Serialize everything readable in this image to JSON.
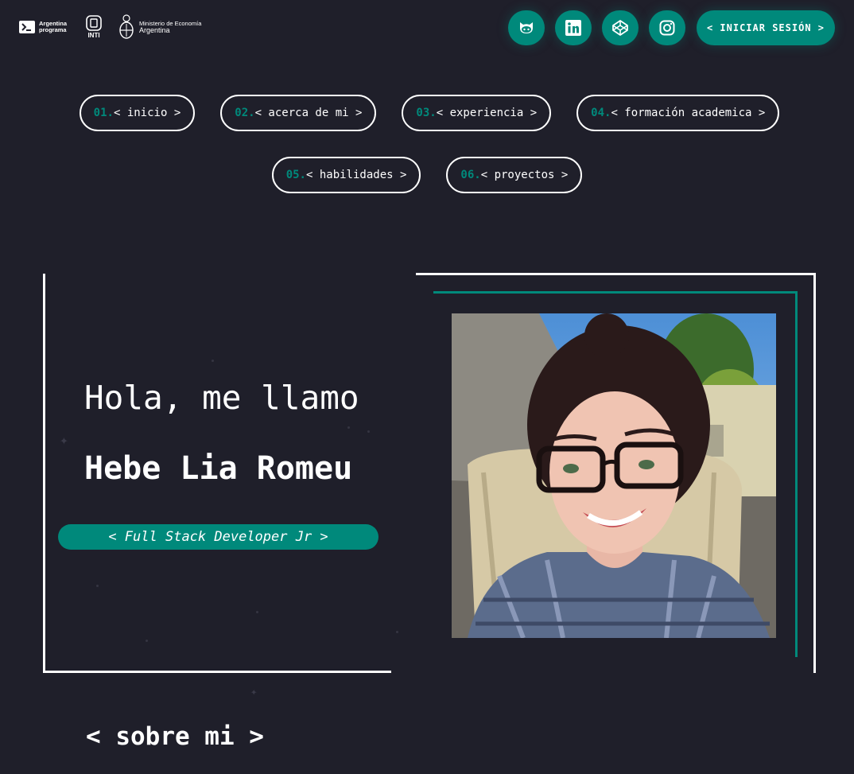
{
  "header": {
    "logos": {
      "argentina_programa": [
        "Argentina",
        "programa"
      ],
      "inti": "INTI",
      "ministerio": [
        "Ministerio de Economía",
        "Argentina"
      ]
    },
    "social": [
      {
        "name": "github",
        "icon": "github-icon"
      },
      {
        "name": "linkedin",
        "icon": "linkedin-icon"
      },
      {
        "name": "codepen",
        "icon": "codepen-icon"
      },
      {
        "name": "instagram",
        "icon": "instagram-icon"
      }
    ],
    "login_label": "< INICIAR SESIÓN >"
  },
  "nav": [
    {
      "num": "01.",
      "label": "< inicio >"
    },
    {
      "num": "02.",
      "label": "< acerca de mi >"
    },
    {
      "num": "03.",
      "label": "< experiencia >"
    },
    {
      "num": "04.",
      "label": "< formación academica >"
    },
    {
      "num": "05.",
      "label": "< habilidades >"
    },
    {
      "num": "06.",
      "label": "< proyectos >"
    }
  ],
  "hero": {
    "greeting": "Hola, me llamo",
    "name": "Hebe Lia Romeu",
    "role": "< Full Stack Developer Jr >"
  },
  "about": {
    "title": "< sobre mi >"
  },
  "colors": {
    "accent": "#00897b",
    "background": "#1f1f2a",
    "text": "#ffffff"
  }
}
